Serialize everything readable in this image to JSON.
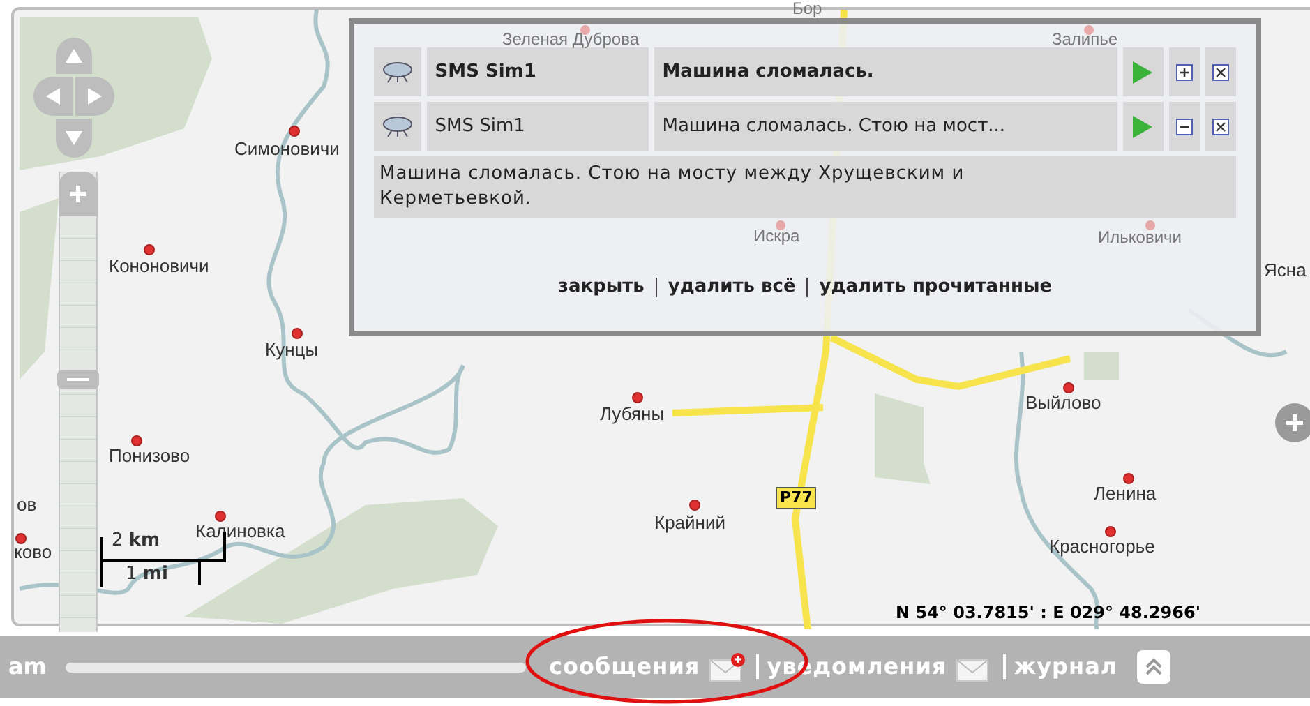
{
  "map": {
    "places": [
      {
        "name": "Зеленая Дуброва",
        "faded": true
      },
      {
        "name": "Бор",
        "faded": true
      },
      {
        "name": "Залипье",
        "faded": true
      },
      {
        "name": "Симоновичи",
        "faded": false
      },
      {
        "name": "Искра",
        "faded": true
      },
      {
        "name": "Ильковичи",
        "faded": true
      },
      {
        "name": "Кононовичи",
        "faded": false
      },
      {
        "name": "Ясна",
        "faded": false
      },
      {
        "name": "Кунцы",
        "faded": false
      },
      {
        "name": "Лубяны",
        "faded": false
      },
      {
        "name": "Выйлово",
        "faded": false
      },
      {
        "name": "Понизово",
        "faded": false
      },
      {
        "name": "Ленина",
        "faded": false
      },
      {
        "name": "ов",
        "faded": false
      },
      {
        "name": "ково",
        "faded": false
      },
      {
        "name": "Калиновка",
        "faded": false
      },
      {
        "name": "Крайний",
        "faded": false
      },
      {
        "name": "Красногорье",
        "faded": false
      }
    ],
    "road_label": "P77",
    "scale": {
      "km": "2 **km**",
      "mi": "1 **mi**"
    },
    "coordinates": "N 54° 03.7815' : E 029° 48.2966'"
  },
  "messages_popup": {
    "messages": [
      {
        "sender": "SMS Sim1",
        "preview": "Машина сломалась.",
        "unread": true,
        "expanded": false
      },
      {
        "sender": "SMS Sim1",
        "preview": "Машина сломалась. Стою на мост...",
        "unread": false,
        "expanded": true
      }
    ],
    "body": "Машина сломалась. Стою на мосту между Хрущевским и Керметьевкой.",
    "actions": [
      "закрыть",
      "удалить всё",
      "удалить прочитанные"
    ]
  },
  "bottom_bar": {
    "left_text": "am",
    "tabs": [
      {
        "label": "сообщения",
        "new_mail": true,
        "highlighted": true
      },
      {
        "label": "уведомления",
        "new_mail": false,
        "highlighted": false
      },
      {
        "label": "журнал",
        "highlighted": false
      }
    ]
  }
}
